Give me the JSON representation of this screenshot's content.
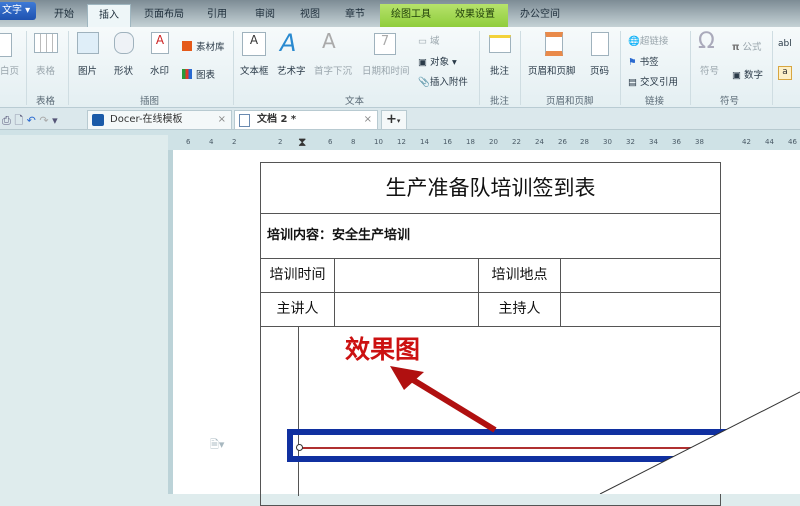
{
  "app": {
    "logo": "文字"
  },
  "menu_tabs": [
    "开始",
    "插入",
    "页面布局",
    "引用",
    "审阅",
    "视图",
    "章节",
    "绘图工具",
    "效果设置",
    "办公空间"
  ],
  "ribbon": {
    "items": {
      "blank_page": "白页",
      "table": "表格",
      "picture": "图片",
      "shape": "形状",
      "watermark": "水印",
      "material": "素材库",
      "chart": "图表",
      "textbox": "文本框",
      "wordart": "艺术字",
      "dropcap": "首字下沉",
      "datetime": "日期和时间",
      "field": "域",
      "object": "对象",
      "attachment": "插入附件",
      "comment": "批注",
      "header_footer": "页眉和页脚",
      "page_num": "页码",
      "hyperlink": "超链接",
      "bookmark": "书签",
      "crossref": "交叉引用",
      "symbol": "符号",
      "formula": "公式",
      "number": "数字",
      "abl": "abl"
    },
    "groups": {
      "table": "表格",
      "illustration": "插图",
      "text": "文本",
      "comment": "批注",
      "header_footer": "页眉和页脚",
      "link": "链接",
      "symbol": "符号"
    }
  },
  "doc_tabs": [
    {
      "label": "Docer-在线模板"
    },
    {
      "label": "文档 2 *"
    }
  ],
  "ruler": [
    "6",
    "4",
    "2",
    "2",
    "6",
    "8",
    "10",
    "12",
    "14",
    "16",
    "18",
    "20",
    "22",
    "24",
    "26",
    "28",
    "30",
    "32",
    "34",
    "36",
    "38",
    "42",
    "44",
    "46"
  ],
  "document": {
    "title": "生产准备队培训签到表",
    "content_label": "培训内容：安全生产培训",
    "time_label": "培训时间",
    "place_label": "培训地点",
    "speaker_label": "主讲人",
    "host_label": "主持人"
  },
  "annotation": {
    "text": "效果图",
    "color": "#cc1111"
  },
  "colors": {
    "highlight": "#1030a0",
    "line": "#b03030"
  }
}
